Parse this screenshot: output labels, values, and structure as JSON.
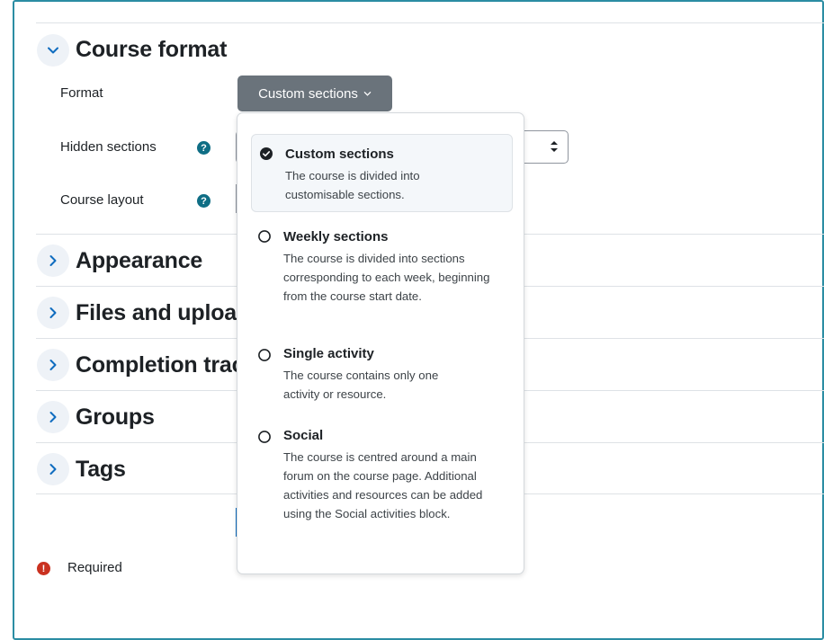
{
  "course_format": {
    "heading": "Course format",
    "format_label": "Format",
    "format_button": "Custom sections",
    "hidden_sections_label": "Hidden sections",
    "course_layout_label": "Course layout",
    "help_glyph": "?"
  },
  "collapsed_sections": [
    {
      "title": "Appearance"
    },
    {
      "title": "Files and uploads"
    },
    {
      "title": "Completion tracking"
    },
    {
      "title": "Groups"
    },
    {
      "title": "Tags"
    }
  ],
  "format_dropdown": {
    "selected": "Custom sections",
    "options": [
      {
        "title": "Custom sections",
        "description": "The course is divided into customisable sections.",
        "checked": true
      },
      {
        "title": "Weekly sections",
        "description": "The course is divided into sections corresponding to each week, beginning from the course start date.",
        "checked": false
      },
      {
        "title": "Single activity",
        "description": "The course contains only one activity or resource.",
        "checked": false
      },
      {
        "title": "Social",
        "description": "The course is centred around a main forum on the course page. Additional activities and resources can be added using the Social activities block.",
        "checked": false
      }
    ]
  },
  "footer": {
    "required_label": "Required",
    "required_glyph": "!"
  },
  "colors": {
    "frame": "#2b8da3",
    "help": "#0f6e85",
    "required": "#ca3120",
    "button": "#6a737b",
    "chevron": "#0f6cbf"
  }
}
